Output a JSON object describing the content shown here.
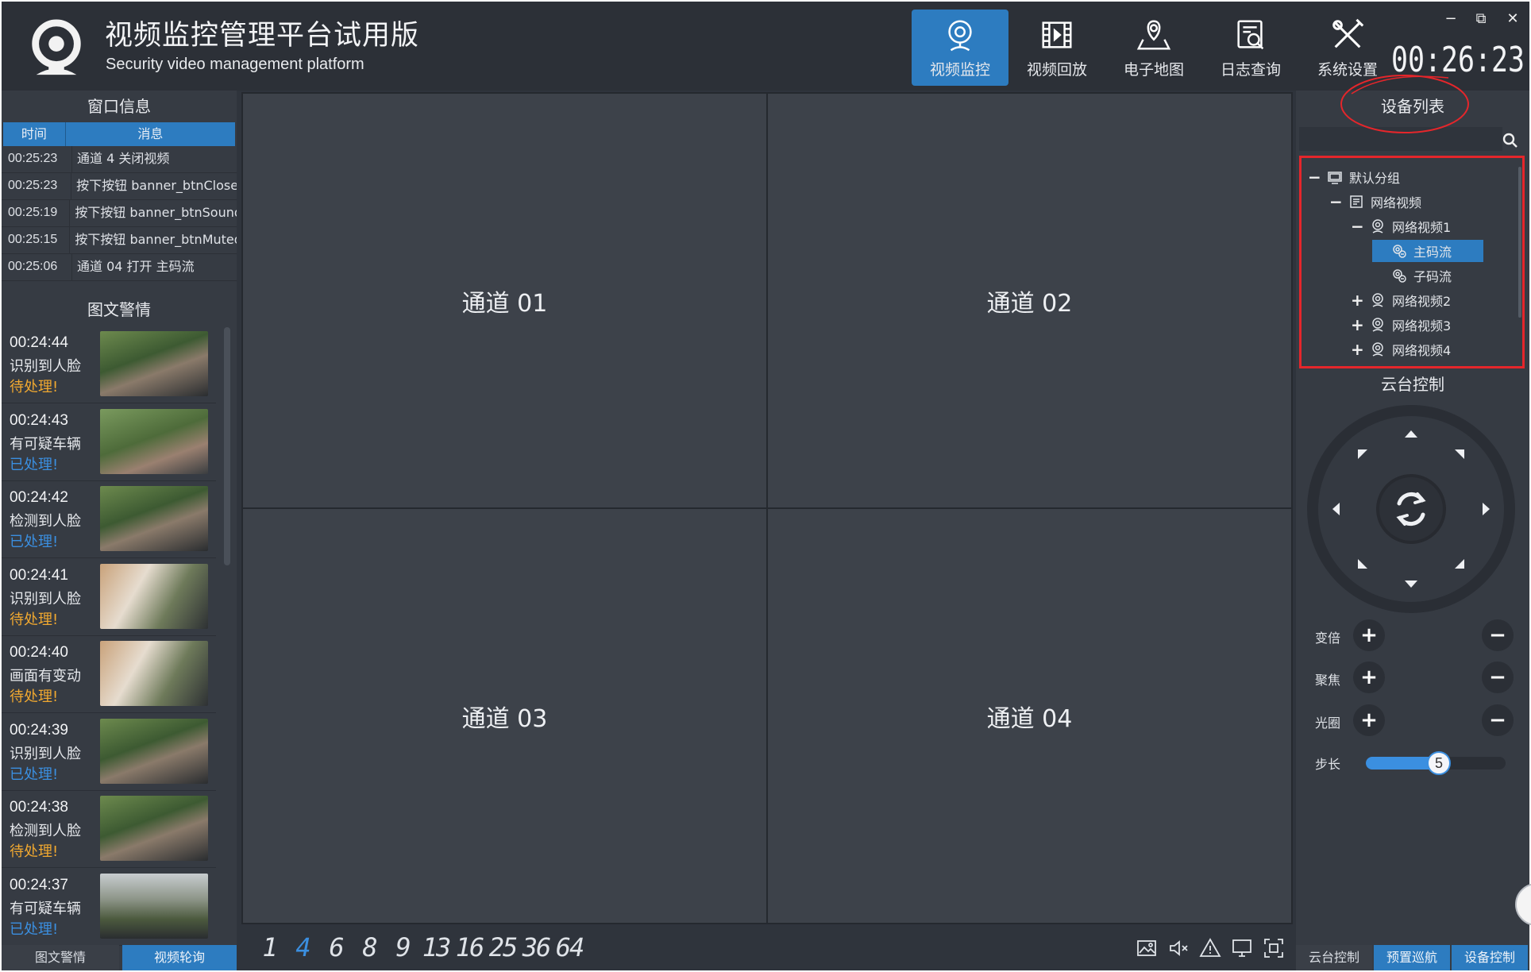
{
  "app": {
    "title": "视频监控管理平台试用版",
    "subtitle": "Security video management platform",
    "clock": "00:26:23"
  },
  "nav": [
    {
      "label": "视频监控",
      "icon": "camera-icon",
      "active": true
    },
    {
      "label": "视频回放",
      "icon": "film-icon",
      "active": false
    },
    {
      "label": "电子地图",
      "icon": "map-pin-icon",
      "active": false
    },
    {
      "label": "日志查询",
      "icon": "log-search-icon",
      "active": false
    },
    {
      "label": "系统设置",
      "icon": "tools-icon",
      "active": false
    }
  ],
  "window_controls": {
    "minimize": "−",
    "restore": "⧉",
    "close": "✕"
  },
  "left": {
    "window_info_title": "窗口信息",
    "columns": [
      "时间",
      "消息"
    ],
    "messages": [
      {
        "time": "00:25:23",
        "msg": "通道 4 关闭视频"
      },
      {
        "time": "00:25:23",
        "msg": "按下按钮 banner_btnClose"
      },
      {
        "time": "00:25:19",
        "msg": "按下按钮 banner_btnSound"
      },
      {
        "time": "00:25:15",
        "msg": "按下按钮 banner_btnMuted"
      },
      {
        "time": "00:25:06",
        "msg": "通道 04 打开 主码流"
      }
    ],
    "alarm_title": "图文警情",
    "alarms": [
      {
        "time": "00:24:44",
        "desc": "识别到人脸",
        "status": "待处理!",
        "pending": true
      },
      {
        "time": "00:24:43",
        "desc": "有可疑车辆",
        "status": "已处理!",
        "pending": false
      },
      {
        "time": "00:24:42",
        "desc": "检测到人脸",
        "status": "已处理!",
        "pending": false
      },
      {
        "time": "00:24:41",
        "desc": "识别到人脸",
        "status": "待处理!",
        "pending": true
      },
      {
        "time": "00:24:40",
        "desc": "画面有变动",
        "status": "待处理!",
        "pending": true
      },
      {
        "time": "00:24:39",
        "desc": "识别到人脸",
        "status": "已处理!",
        "pending": false
      },
      {
        "time": "00:24:38",
        "desc": "检测到人脸",
        "status": "待处理!",
        "pending": true
      },
      {
        "time": "00:24:37",
        "desc": "有可疑车辆",
        "status": "已处理!",
        "pending": false
      }
    ],
    "tabs": [
      "图文警情",
      "视频轮询"
    ]
  },
  "channels": [
    "通道 01",
    "通道 02",
    "通道 03",
    "通道 04"
  ],
  "layouts": {
    "options": [
      "1",
      "4",
      "6",
      "8",
      "9",
      "13",
      "16",
      "25",
      "36",
      "64"
    ],
    "selected": "4"
  },
  "tools": [
    "snapshot-icon",
    "mute-icon",
    "alarm-icon",
    "screen-icon",
    "fullscreen-icon"
  ],
  "right": {
    "device_list_title": "设备列表",
    "search_placeholder": "",
    "tree": [
      {
        "label": "默认分组",
        "level": 0,
        "toggle": "−",
        "icon": "group-icon"
      },
      {
        "label": "网络视频",
        "level": 1,
        "toggle": "−",
        "icon": "nvr-icon"
      },
      {
        "label": "网络视频1",
        "level": 2,
        "toggle": "−",
        "icon": "webcam-icon"
      },
      {
        "label": "主码流",
        "level": 3,
        "toggle": "",
        "icon": "stream-icon",
        "selected": true
      },
      {
        "label": "子码流",
        "level": 3,
        "toggle": "",
        "icon": "stream-icon"
      },
      {
        "label": "网络视频2",
        "level": 2,
        "toggle": "+",
        "icon": "webcam-icon"
      },
      {
        "label": "网络视频3",
        "level": 2,
        "toggle": "+",
        "icon": "webcam-icon"
      },
      {
        "label": "网络视频4",
        "level": 2,
        "toggle": "+",
        "icon": "webcam-icon"
      }
    ],
    "ptz_title": "云台控制",
    "controls": [
      {
        "label": "变倍"
      },
      {
        "label": "聚焦"
      },
      {
        "label": "光圈"
      }
    ],
    "step": {
      "label": "步长",
      "value": 5,
      "min": 1,
      "max": 10
    },
    "tabs": [
      "云台控制",
      "预置巡航",
      "设备控制"
    ]
  },
  "colors": {
    "accent": "#2d7cc0",
    "pending": "#f0a830",
    "done": "#3b8fe0",
    "highlight": "#e5262b"
  }
}
